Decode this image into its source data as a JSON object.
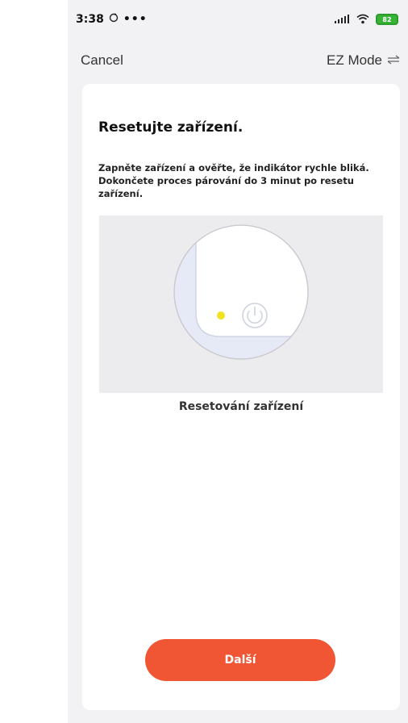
{
  "status_bar": {
    "time": "3:38",
    "dots": "•••",
    "battery": "82"
  },
  "nav": {
    "cancel_label": "Cancel",
    "mode_label": "EZ Mode"
  },
  "content": {
    "title": "Resetujte zařízení.",
    "description_line1": "Zapněte zařízení a ověřte, že indikátor rychle bliká.",
    "description_line2": "Dokončete proces párování do 3 minut po resetu zařízení.",
    "caption": "Resetování zařízení",
    "next_label": "Další"
  },
  "colors": {
    "accent": "#f05534",
    "indicator": "#f2e21f",
    "battery": "#38b338"
  }
}
